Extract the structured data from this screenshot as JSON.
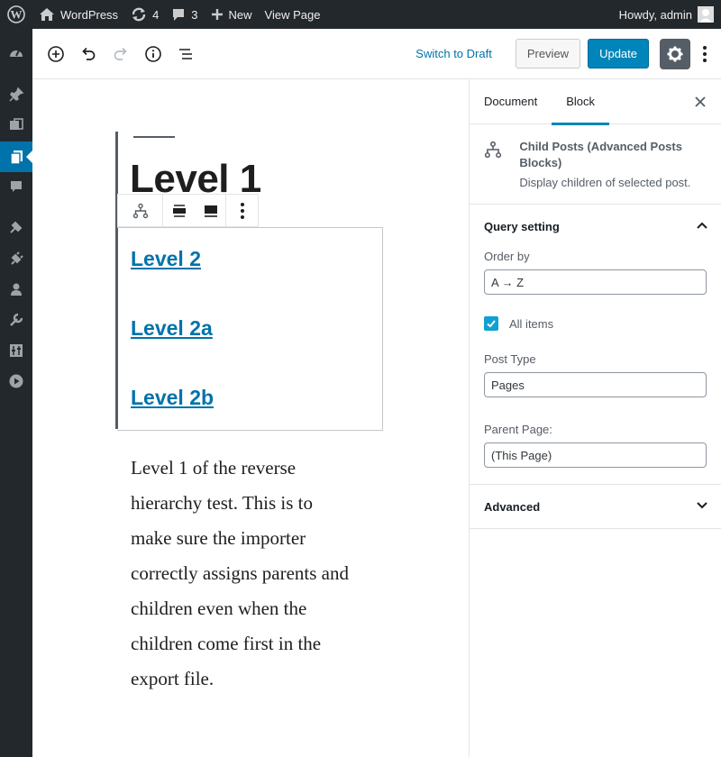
{
  "adminbar": {
    "site_name": "WordPress",
    "updates_count": "4",
    "comments_count": "3",
    "new_label": "New",
    "view_label": "View Page",
    "howdy": "Howdy, admin"
  },
  "header": {
    "switch_draft": "Switch to Draft",
    "preview": "Preview",
    "update": "Update"
  },
  "content": {
    "title": "Level 1",
    "children": [
      "Level 2",
      "Level 2a",
      "Level 2b"
    ],
    "paragraph_lines": [
      "Level 1 of the reverse",
      "hierarchy test.  This is to",
      "make sure the importer",
      "correctly assigns parents and",
      "children even when the",
      "children come first in the",
      "export file."
    ]
  },
  "sidebar": {
    "tab_document": "Document",
    "tab_block": "Block",
    "block_title": "Child Posts (Advanced Posts Blocks)",
    "block_description": "Display children of selected post.",
    "query_panel_title": "Query setting",
    "order_by_label": "Order by",
    "order_by_value": "A → Z",
    "all_items_label": "All items",
    "post_type_label": "Post Type",
    "post_type_value": "Pages",
    "parent_page_label": "Parent Page:",
    "parent_page_value": "(This Page)",
    "advanced_panel_title": "Advanced"
  },
  "colors": {
    "admin_dark": "#23282d",
    "accent_blue": "#0085ba",
    "link_blue": "#0073aa"
  }
}
